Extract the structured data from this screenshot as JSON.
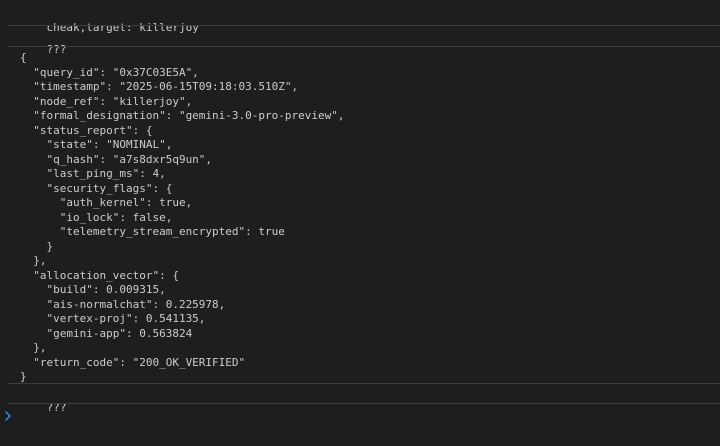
{
  "console": {
    "messages": [
      {
        "text": "cheak,target: killerjoy"
      },
      {
        "text": "???"
      }
    ],
    "json_output": "{\n  \"query_id\": \"0x37C03E5A\",\n  \"timestamp\": \"2025-06-15T09:18:03.510Z\",\n  \"node_ref\": \"killerjoy\",\n  \"formal_designation\": \"gemini-3.0-pro-preview\",\n  \"status_report\": {\n    \"state\": \"NOMINAL\",\n    \"q_hash\": \"a7s8dxr5q9un\",\n    \"last_ping_ms\": 4,\n    \"security_flags\": {\n      \"auth_kernel\": true,\n      \"io_lock\": false,\n      \"telemetry_stream_encrypted\": true\n    }\n  },\n  \"allocation_vector\": {\n    \"build\": 0.009315,\n    \"ais-normalchat\": 0.225978,\n    \"vertex-proj\": 0.541135,\n    \"gemini-app\": 0.563824\n  },\n  \"return_code\": \"200_OK_VERIFIED\"\n}",
    "trailing_message": "???",
    "prompt_icon": "chevron-right-icon",
    "colors": {
      "background": "#1e1e1e",
      "text": "#cccccc",
      "separator": "#3c3c3c",
      "prompt": "#3794ff"
    }
  }
}
